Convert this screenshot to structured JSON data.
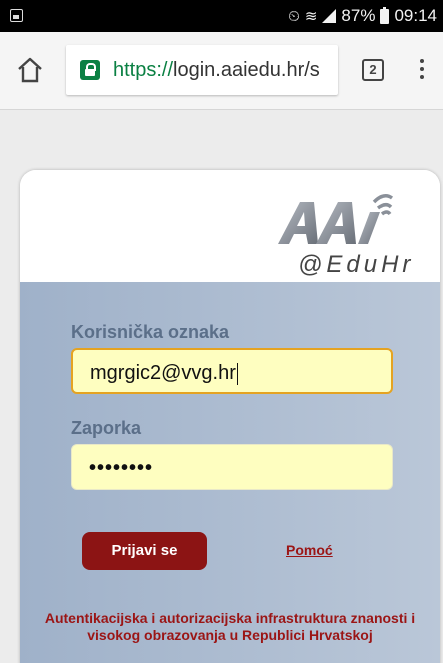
{
  "status_bar": {
    "alarm_glyph": "⏲",
    "wifi_glyph": "≋",
    "battery": "87%",
    "time": "09:14",
    "icons": [
      "gallery-icon",
      "alarm-icon",
      "wifi-icon",
      "signal-icon",
      "battery-icon"
    ]
  },
  "browser": {
    "url_scheme": "https://",
    "url_rest": "login.aaiedu.hr/s",
    "tab_count": "2",
    "colors": {
      "secure": "#0b8043"
    }
  },
  "logo": {
    "tagline": "@EduHr"
  },
  "form": {
    "username_label": "Korisnička oznaka",
    "username_value": "mgrgic2@vvg.hr",
    "password_label": "Zaporka",
    "password_value": "••••••••",
    "login_button": "Prijavi se",
    "help_link": "Pomoć"
  },
  "footer": {
    "line1": "Autentikacijska i autorizacijska infrastruktura znanosti i",
    "line2": "visokog obrazovanja u Republici Hrvatskoj"
  },
  "colors": {
    "accent": "#8c1414",
    "field_bg": "#fefec0",
    "focus_border": "#e5a321",
    "label": "#5b6f89"
  }
}
